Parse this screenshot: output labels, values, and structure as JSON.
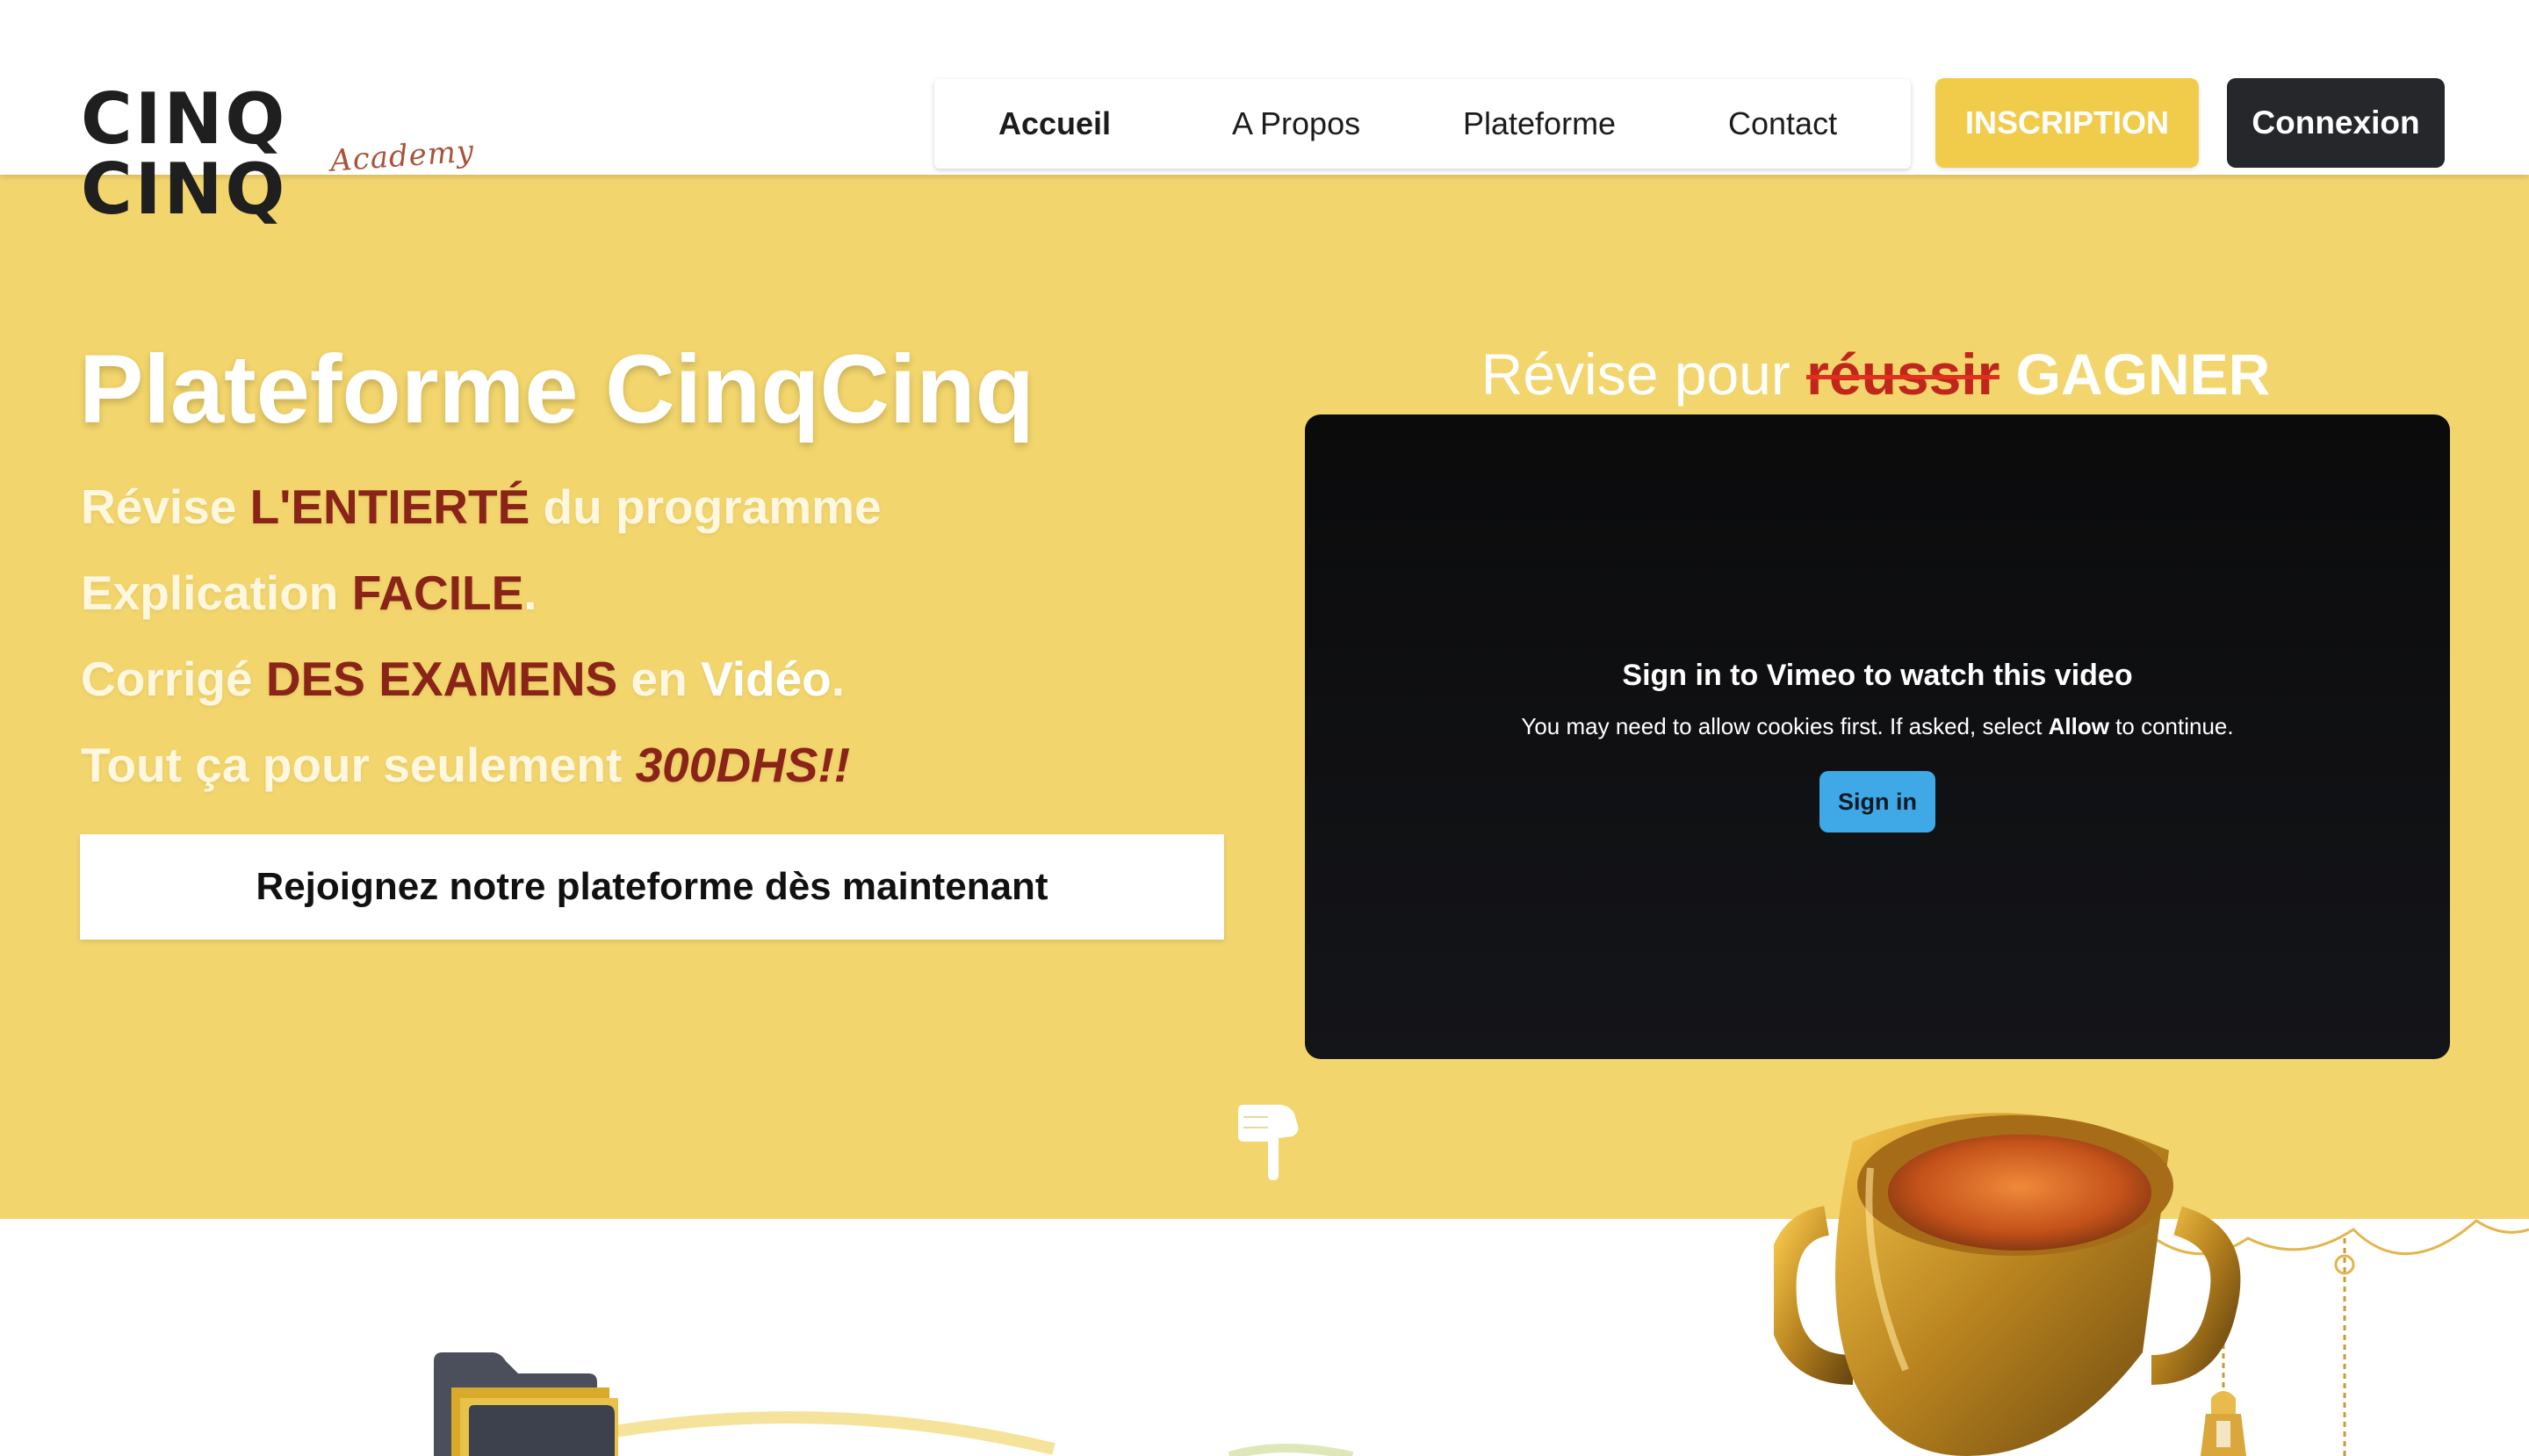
{
  "header": {
    "logo_text": "CINQ CINQ",
    "logo_script": "Academy",
    "nav": [
      {
        "label": "Accueil",
        "active": true
      },
      {
        "label": "A Propos",
        "active": false
      },
      {
        "label": "Plateforme",
        "active": false
      },
      {
        "label": "Contact",
        "active": false
      }
    ],
    "inscription_label": "INSCRIPTION",
    "connexion_label": "Connexion"
  },
  "hero": {
    "title": "Plateforme CinqCinq",
    "line1": {
      "a": "Révise ",
      "b": "L'ENTIERTÉ",
      "c": " du programme"
    },
    "line2": {
      "a": "Explication ",
      "b": "FACILE",
      "c": "."
    },
    "line3": {
      "a": "Corrigé ",
      "b": "DES EXAMENS",
      "c": " en ",
      "d": "Vidéo",
      "e": "."
    },
    "line4": {
      "a": "Tout ça pour seulement ",
      "b": "300DHS!!"
    },
    "cta_label": "Rejoignez notre plateforme dès maintenant"
  },
  "video": {
    "heading_prefix": "Révise pour ",
    "heading_strike": "réussir",
    "heading_suffix": " GAGNER",
    "title": "Sign in to Vimeo to watch this video",
    "msg_prefix": "You may need to allow cookies first. If asked, select ",
    "msg_bold": "Allow",
    "msg_suffix": " to continue.",
    "signin_label": "Sign in"
  },
  "colors": {
    "hero_bg": "#f2d56c",
    "accent_yellow": "#f1cc4b",
    "dark_button": "#25272a",
    "highlight_red": "#8a2419",
    "vimeo_blue": "#3fa8e6"
  },
  "icons": {
    "pointer": "pointing-hand-icon",
    "trophy": "trophy-icon",
    "folder": "folder-icon",
    "lantern": "lantern-garland-icon"
  }
}
